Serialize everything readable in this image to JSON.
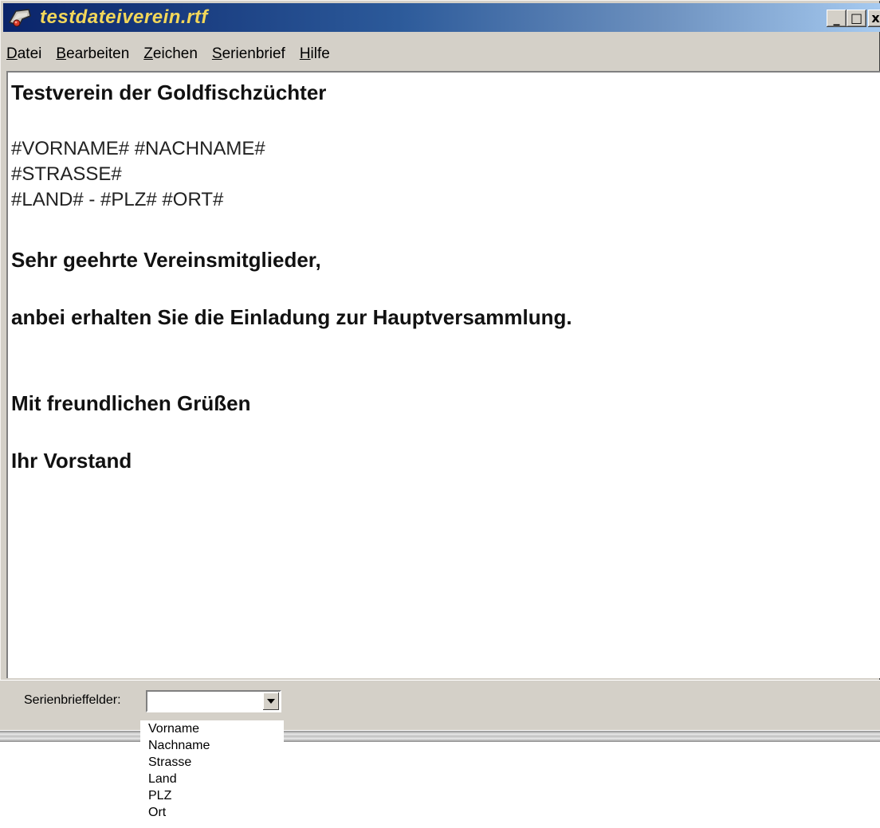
{
  "window": {
    "title": "testdateiverein.rtf",
    "controls": {
      "minimize": "_",
      "maximize": "□",
      "close": "x"
    }
  },
  "menu": [
    {
      "label": "Datei",
      "accel": "D",
      "rest": "atei"
    },
    {
      "label": "Bearbeiten",
      "accel": "B",
      "rest": "earbeiten"
    },
    {
      "label": "Zeichen",
      "accel": "Z",
      "rest": "eichen"
    },
    {
      "label": "Serienbrief",
      "accel": "S",
      "rest": "erienbrief"
    },
    {
      "label": "Hilfe",
      "accel": "H",
      "rest": "ilfe"
    }
  ],
  "document": {
    "heading": "Testverein der Goldfischzüchter",
    "address_line1": "#VORNAME# #NACHNAME#",
    "address_line2": "#STRASSE#",
    "address_line3": "#LAND# - #PLZ# #ORT#",
    "salutation": "Sehr geehrte Vereinsmitglieder,",
    "body": "anbei erhalten Sie die Einladung zur Hauptversammlung.",
    "closing": "Mit freundlichen Grüßen",
    "signature": "Ihr Vorstand"
  },
  "footer": {
    "label": "Serienbrieffelder:",
    "selected_value": "",
    "options": [
      "Vorname",
      "Nachname",
      "Strasse",
      "Land",
      "PLZ",
      "Ort"
    ]
  },
  "icons": {
    "app": "app-icon",
    "dropdown": "chevron-down-icon"
  },
  "colors": {
    "title_text": "#f3d75a",
    "titlebar_start": "#0a246a",
    "titlebar_end": "#a6caf0",
    "window_face": "#d4d0c8"
  }
}
